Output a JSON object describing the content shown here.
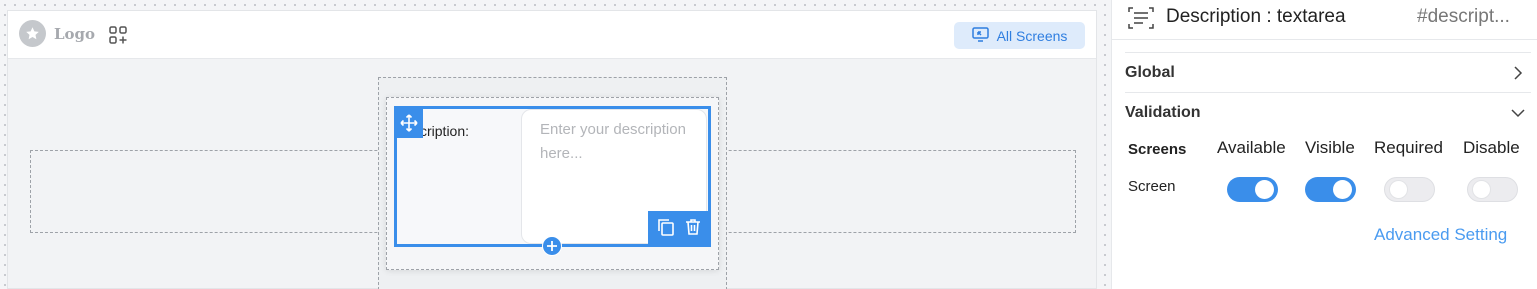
{
  "canvas": {
    "logo_text": "Logo",
    "all_screens_label": "All Screens"
  },
  "field": {
    "label": "Description:",
    "label_visible": "cription:",
    "placeholder": "Enter your description here..."
  },
  "panel": {
    "title": "Description : textarea",
    "element_id": "#descript...",
    "sections": [
      {
        "label": "Global",
        "expanded": false
      },
      {
        "label": "Validation",
        "expanded": true
      }
    ],
    "validation": {
      "columns": [
        "Screens",
        "Available",
        "Visible",
        "Required",
        "Disable"
      ],
      "rows": [
        {
          "screen": "Screen",
          "available": true,
          "visible": true,
          "required": false,
          "disable": false
        }
      ]
    },
    "advanced_setting_label": "Advanced Setting"
  },
  "colors": {
    "accent": "#3a8eea",
    "pill_background": "#deebfb",
    "link": "#4a9bf0"
  },
  "icons": {
    "logo": "star-icon",
    "widgets": "add-widget-icon",
    "all_screens": "screen-share-icon",
    "move": "move-arrows-icon",
    "duplicate": "copy-icon",
    "delete": "trash-icon",
    "add": "plus-icon",
    "textarea": "textarea-type-icon",
    "collapsed": "chevron-right-icon",
    "expanded": "chevron-down-icon"
  }
}
